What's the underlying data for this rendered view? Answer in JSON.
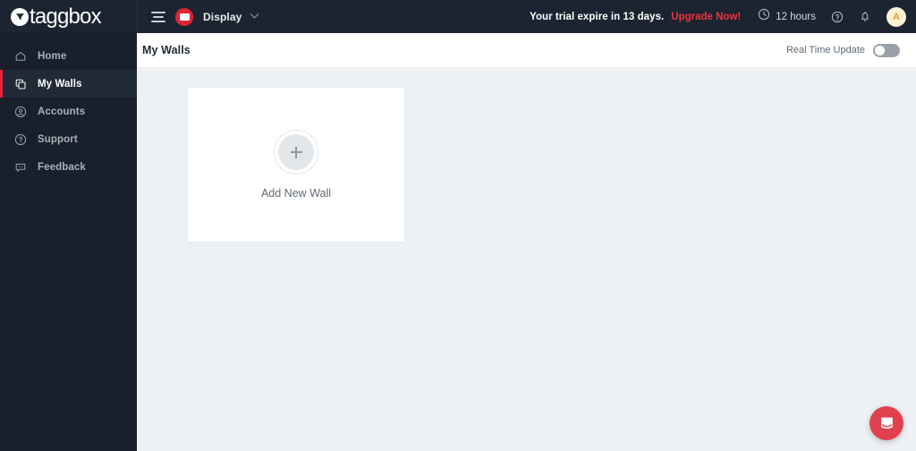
{
  "app": {
    "brand": "taggbox",
    "brand_logo_icon": "taggbox-circle-logo-icon"
  },
  "topbar": {
    "menu_icon": "hamburger-menu-icon",
    "display_badge_icon": "display-card-icon",
    "display_label": "Display",
    "display_chevron_icon": "chevron-down-icon",
    "trial_text": "Your trial expire in 13 days.",
    "upgrade_label": "Upgrade Now!",
    "clock_icon": "clock-icon",
    "hours_text": "12 hours",
    "help_icon": "help-circle-icon",
    "bell_icon": "bell-icon",
    "avatar_initial": "A"
  },
  "sidebar": {
    "items": [
      {
        "label": "Home",
        "icon": "home-icon",
        "active": false
      },
      {
        "label": "My Walls",
        "icon": "layers-copy-icon",
        "active": true
      },
      {
        "label": "Accounts",
        "icon": "user-circle-icon",
        "active": false
      },
      {
        "label": "Support",
        "icon": "question-circle-icon",
        "active": false
      },
      {
        "label": "Feedback",
        "icon": "chat-bubble-icon",
        "active": false
      }
    ]
  },
  "content": {
    "page_title": "My Walls",
    "real_time_label": "Real Time Update",
    "real_time_enabled": false,
    "add_wall": {
      "icon": "plus-icon",
      "label": "Add New Wall"
    }
  },
  "chat": {
    "launcher_icon": "intercom-chat-icon"
  },
  "colors": {
    "topbar_bg": "#1b2430",
    "sidebar_bg": "#19202b",
    "sidebar_active_bg": "#212a37",
    "accent_red": "#e8233a",
    "upgrade_red": "#f0323f",
    "content_bg": "#eef1f4",
    "chat_red": "#e0414f",
    "avatar_bg": "#fdf1d4",
    "avatar_fg": "#eb9b2d"
  }
}
